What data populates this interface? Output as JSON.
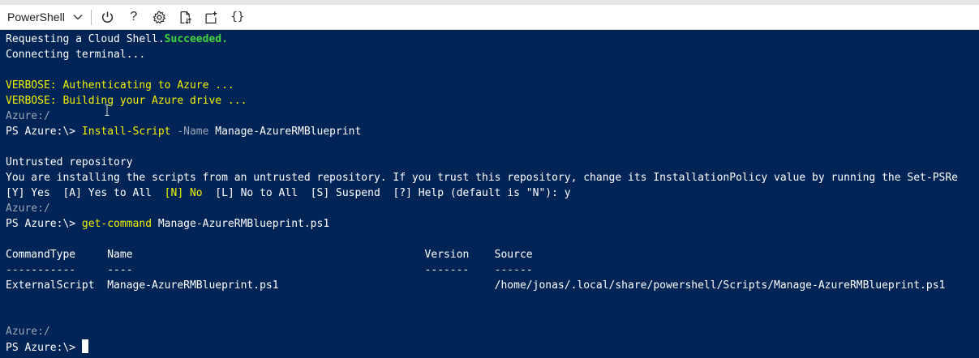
{
  "toolbar": {
    "shell_label": "PowerShell",
    "icons": [
      "chevron-down-icon",
      "power-icon",
      "help-icon",
      "gear-icon",
      "upload-download-icon",
      "new-session-icon",
      "braces-icon"
    ],
    "help_glyph": "?",
    "braces_glyph": "{}"
  },
  "colors": {
    "terminal_bg": "#012456",
    "yellow": "#f2f200",
    "success_green": "#3ed63e",
    "gray": "#9aa5b5"
  },
  "terminal": {
    "l1_text": "Requesting a Cloud Shell.",
    "l1_success": "Succeeded.",
    "l2": "Connecting terminal...",
    "l4": "VERBOSE: Authenticating to Azure ...",
    "l5": "VERBOSE: Building your Azure drive ...",
    "l6": "Azure:/",
    "l7_prompt": "PS Azure:\\> ",
    "l7_cmd": "Install-Script",
    "l7_param": " -Name",
    "l7_arg": " Manage-AzureRMBlueprint",
    "l9": "Untrusted repository",
    "l10": "You are installing the scripts from an untrusted repository. If you trust this repository, change its InstallationPolicy value by running the Set-PSRe",
    "l11_a": "[Y] Yes  [A] Yes to All  ",
    "l11_b": "[N] No",
    "l11_c": "  [L] No to All  [S] Suspend  [?] Help (default is \"N\"): y",
    "l12": "Azure:/",
    "l13_prompt": "PS Azure:\\> ",
    "l13_cmd": "get-command",
    "l13_arg": " Manage-AzureRMBlueprint.ps1",
    "l15": "CommandType     Name                                              Version    Source",
    "l16": "-----------     ----                                              -------    ------",
    "l17": "ExternalScript  Manage-AzureRMBlueprint.ps1                                  /home/jonas/.local/share/powershell/Scripts/Manage-AzureRMBlueprint.ps1",
    "l20": "Azure:/",
    "l21_prompt": "PS Azure:\\> "
  }
}
